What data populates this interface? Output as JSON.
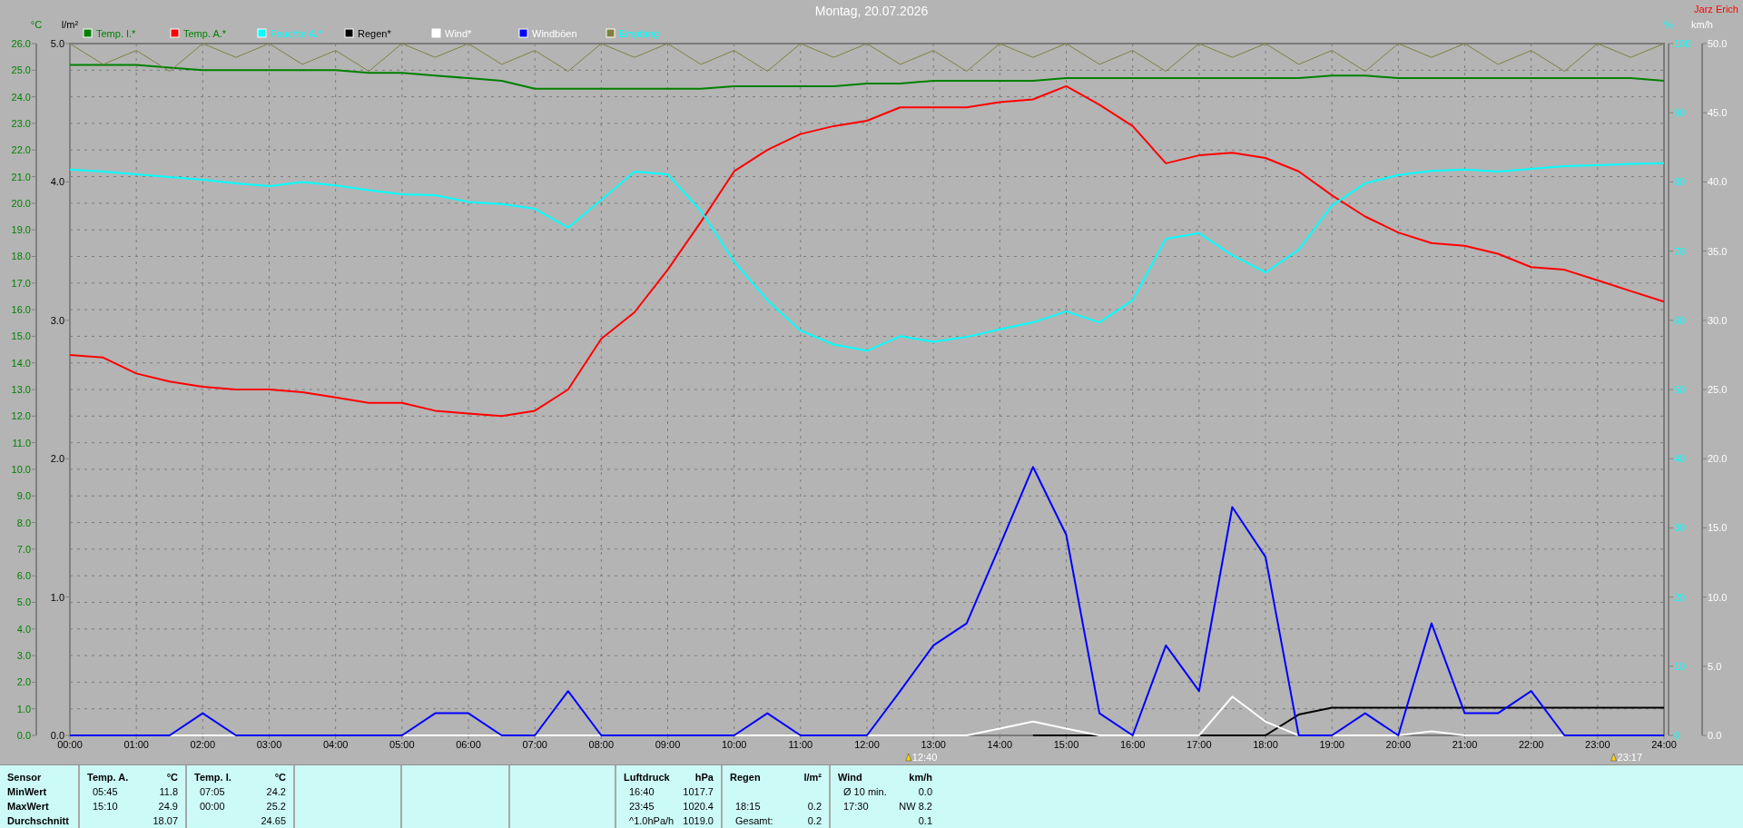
{
  "author": "Jarz Erich",
  "charts": [
    {
      "chart_data": {
        "type": "line",
        "title": "Montag, 20.07.2026",
        "ylabel": "°C",
        "y2label": "l/m²",
        "y3label": "%",
        "x": [
          0,
          0.5,
          1,
          1.5,
          2,
          2.5,
          3,
          3.5,
          4,
          4.5,
          5,
          5.5,
          6,
          6.5,
          7,
          7.5,
          8,
          8.5,
          9,
          9.5,
          10,
          10.5,
          11,
          11.5,
          12,
          12.5,
          13,
          13.5,
          14,
          14.5,
          15,
          15.5,
          16,
          16.5,
          17,
          17.5,
          18,
          18.5,
          19,
          19.5,
          20,
          20.5,
          21,
          21.5,
          22,
          22.5,
          23,
          23.5,
          24
        ],
        "xlim": [
          0,
          24
        ],
        "xticks": [
          {
            "value": 0,
            "label": "00:00"
          },
          {
            "value": 1,
            "label": "01:00"
          },
          {
            "value": 2,
            "label": "02:00"
          },
          {
            "value": 3,
            "label": "03:00"
          },
          {
            "value": 4,
            "label": "04:00"
          },
          {
            "value": 5,
            "label": "05:00"
          },
          {
            "value": 6,
            "label": "06:00"
          },
          {
            "value": 7,
            "label": "07:00"
          },
          {
            "value": 8,
            "label": "08:00"
          },
          {
            "value": 9,
            "label": "09:00"
          },
          {
            "value": 10,
            "label": "10:00"
          },
          {
            "value": 11,
            "label": "11:00"
          },
          {
            "value": 12,
            "label": "12:00"
          },
          {
            "value": 13,
            "label": "13:00"
          },
          {
            "value": 14,
            "label": "14:00"
          },
          {
            "value": 15,
            "label": "15:00"
          },
          {
            "value": 16,
            "label": "16:00"
          },
          {
            "value": 17,
            "label": "17:00"
          },
          {
            "value": 18,
            "label": "18:00"
          },
          {
            "value": 19,
            "label": "19:00"
          },
          {
            "value": 20,
            "label": "20:00"
          },
          {
            "value": 21,
            "label": "21:00"
          },
          {
            "value": 22,
            "label": "22:00"
          },
          {
            "value": 23,
            "label": "23:00"
          },
          {
            "value": 24,
            "label": "24:00"
          }
        ],
        "ylim": [
          0,
          26
        ],
        "yticks": [
          {
            "value": 0,
            "label": "0.0"
          },
          {
            "value": 1,
            "label": "1.0"
          },
          {
            "value": 2,
            "label": "2.0"
          },
          {
            "value": 3,
            "label": "3.0"
          },
          {
            "value": 4,
            "label": "4.0"
          },
          {
            "value": 5,
            "label": "5.0"
          },
          {
            "value": 6,
            "label": "6.0"
          },
          {
            "value": 7,
            "label": "7.0"
          },
          {
            "value": 8,
            "label": "8.0"
          },
          {
            "value": 9,
            "label": "9.0"
          },
          {
            "value": 10,
            "label": "10.0"
          },
          {
            "value": 11,
            "label": "11.0"
          },
          {
            "value": 12,
            "label": "12.0"
          },
          {
            "value": 13,
            "label": "13.0"
          },
          {
            "value": 14,
            "label": "14.0"
          },
          {
            "value": 15,
            "label": "15.0"
          },
          {
            "value": 16,
            "label": "16.0"
          },
          {
            "value": 17,
            "label": "17.0"
          },
          {
            "value": 18,
            "label": "18.0"
          },
          {
            "value": 19,
            "label": "19.0"
          },
          {
            "value": 20,
            "label": "20.0"
          },
          {
            "value": 21,
            "label": "21.0"
          },
          {
            "value": 22,
            "label": "22.0"
          },
          {
            "value": 23,
            "label": "23.0"
          },
          {
            "value": 24,
            "label": "24.0"
          },
          {
            "value": 25,
            "label": "25.0"
          },
          {
            "value": 26,
            "label": "26.0"
          }
        ],
        "y2lim": [
          0,
          5
        ],
        "y2ticks": [
          {
            "value": 0,
            "label": "0.0"
          },
          {
            "value": 1,
            "label": "1.0"
          },
          {
            "value": 2,
            "label": "2.0"
          },
          {
            "value": 3,
            "label": "3.0"
          },
          {
            "value": 4,
            "label": "4.0"
          },
          {
            "value": 5,
            "label": "5.0"
          }
        ],
        "y3lim": [
          0,
          100
        ],
        "y3ticks": [
          0,
          10,
          20,
          30,
          40,
          50,
          60,
          70,
          80,
          90,
          100
        ],
        "series": [
          {
            "name": "Temp. I.*",
            "color": "#008000",
            "values": [
              25.2,
              25.2,
              25.2,
              25.1,
              25.0,
              25.0,
              25.0,
              25.0,
              25.0,
              24.9,
              24.9,
              24.8,
              24.7,
              24.6,
              24.3,
              24.3,
              24.3,
              24.3,
              24.3,
              24.3,
              24.4,
              24.4,
              24.4,
              24.4,
              24.5,
              24.5,
              24.6,
              24.6,
              24.6,
              24.6,
              24.7,
              24.7,
              24.7,
              24.7,
              24.7,
              24.7,
              24.7,
              24.7,
              24.8,
              24.8,
              24.7,
              24.7,
              24.7,
              24.7,
              24.7,
              24.7,
              24.7,
              24.7,
              24.6
            ]
          },
          {
            "name": "Temp. A.*",
            "color": "#ff0000",
            "values": [
              14.3,
              14.2,
              13.6,
              13.3,
              13.1,
              13.0,
              13.0,
              12.9,
              12.7,
              12.5,
              12.5,
              12.2,
              12.1,
              12.0,
              12.2,
              13.0,
              14.9,
              15.9,
              17.5,
              19.3,
              21.2,
              22.0,
              22.6,
              22.9,
              23.1,
              23.6,
              23.6,
              23.6,
              23.8,
              23.9,
              24.4,
              23.7,
              22.9,
              21.5,
              21.8,
              21.9,
              21.7,
              21.2,
              20.3,
              19.5,
              18.9,
              18.5,
              18.4,
              18.1,
              17.6,
              17.5,
              17.1,
              16.7,
              16.3
            ]
          },
          {
            "name": "Feuchte A.*",
            "color": "#00ffff",
            "axis": "y3",
            "values": [
              81.8,
              81.5,
              81.1,
              80.7,
              80.3,
              79.8,
              79.4,
              80.0,
              79.5,
              78.8,
              78.2,
              78.1,
              77.1,
              76.8,
              76.1,
              73.4,
              77.4,
              81.5,
              81.1,
              75.8,
              68.5,
              62.9,
              58.5,
              56.5,
              55.6,
              57.7,
              56.9,
              57.6,
              58.7,
              59.7,
              61.3,
              59.7,
              62.9,
              71.8,
              72.6,
              69.4,
              66.9,
              70.2,
              76.6,
              79.8,
              81.0,
              81.6,
              81.8,
              81.5,
              81.9,
              82.3,
              82.4,
              82.6,
              82.7
            ]
          },
          {
            "name": "Regen*",
            "color": "#000000",
            "axis": "y2",
            "values": [
              null,
              null,
              null,
              null,
              null,
              null,
              null,
              null,
              null,
              null,
              null,
              null,
              null,
              null,
              null,
              null,
              null,
              null,
              null,
              null,
              null,
              null,
              null,
              null,
              null,
              null,
              null,
              null,
              null,
              0,
              0,
              0,
              0,
              0,
              0,
              0,
              0,
              0.15,
              0.2,
              0.2,
              0.2,
              0.2,
              0.2,
              0.2,
              0.2,
              0.2,
              0.2,
              0.2,
              0.2
            ]
          },
          {
            "name": "Empfang",
            "color": "#808040",
            "axis": "y3",
            "values": [
              100,
              97,
              99,
              96,
              100,
              98,
              100,
              97,
              99,
              96,
              100,
              98,
              100,
              97,
              99,
              96,
              100,
              98,
              100,
              97,
              99,
              96,
              100,
              98,
              100,
              97,
              99,
              96,
              100,
              98,
              100,
              97,
              99,
              96,
              100,
              98,
              100,
              97,
              99,
              96,
              100,
              98,
              100,
              97,
              99,
              96,
              100,
              98,
              100
            ]
          }
        ],
        "annotations": [
          "12:40",
          "23:17"
        ],
        "grid": true,
        "legend": "top"
      }
    },
    {
      "chart_data": {
        "type": "line",
        "ylabel": "km/h",
        "legend": "top",
        "x": [
          0,
          0.5,
          1,
          1.5,
          2,
          2.5,
          3,
          3.5,
          4,
          4.5,
          5,
          5.5,
          6,
          6.5,
          7,
          7.5,
          8,
          8.5,
          9,
          9.5,
          10,
          10.5,
          11,
          11.5,
          12,
          12.5,
          13,
          13.5,
          14,
          14.5,
          15,
          15.5,
          16,
          16.5,
          17,
          17.5,
          18,
          18.5,
          19,
          19.5,
          20,
          20.5,
          21,
          21.5,
          22,
          22.5,
          23,
          23.5,
          24
        ],
        "xlim": [
          0,
          24
        ],
        "ylim": [
          0,
          50
        ],
        "yticks": [
          {
            "value": 0,
            "label": "0.0"
          },
          {
            "value": 5,
            "label": "5.0"
          },
          {
            "value": 10,
            "label": "10.0"
          },
          {
            "value": 15,
            "label": "15.0"
          },
          {
            "value": 20,
            "label": "20.0"
          },
          {
            "value": 25,
            "label": "25.0"
          },
          {
            "value": 30,
            "label": "30.0"
          },
          {
            "value": 35,
            "label": "35.0"
          },
          {
            "value": 40,
            "label": "40.0"
          },
          {
            "value": 45,
            "label": "45.0"
          },
          {
            "value": 50,
            "label": "50.0"
          }
        ],
        "series": [
          {
            "name": "Wind*",
            "color": "#ffffff",
            "values": [
              null,
              null,
              0,
              0,
              0,
              0,
              0,
              0,
              0,
              0,
              0,
              0,
              0,
              0,
              0,
              0,
              0,
              0,
              0,
              0,
              0,
              0,
              0,
              0,
              0,
              0,
              0,
              0,
              0.5,
              1.0,
              0.5,
              0,
              0,
              0,
              0,
              2.8,
              1.0,
              0,
              0,
              0,
              0,
              0.3,
              0,
              0,
              0,
              0,
              0,
              null,
              null
            ]
          },
          {
            "name": "Windböen",
            "color": "#0000ff",
            "values": [
              0,
              0,
              0,
              0,
              1.6,
              0,
              0,
              0,
              0,
              0,
              0,
              1.6,
              1.6,
              0,
              0,
              3.2,
              0,
              0,
              0,
              0,
              0,
              1.6,
              0,
              0,
              0,
              3.2,
              6.5,
              8.1,
              13.7,
              19.4,
              14.5,
              1.6,
              0,
              6.5,
              3.2,
              16.5,
              12.9,
              0,
              0,
              1.6,
              0,
              8.1,
              1.6,
              1.6,
              3.2,
              0,
              0,
              0,
              0
            ]
          }
        ]
      }
    }
  ],
  "table": {
    "sections": [
      {
        "kind": "labels",
        "rows": [
          [
            "Sensor"
          ],
          [
            "MinWert"
          ],
          [
            "MaxWert"
          ],
          [
            "Durchschnitt"
          ]
        ]
      },
      {
        "kind": "values",
        "rows": [
          [
            "Temp. A.",
            "°C"
          ],
          [
            "05:45",
            "11.8"
          ],
          [
            "15:10",
            "24.9"
          ],
          [
            null,
            "18.07"
          ]
        ]
      },
      {
        "kind": "values",
        "rows": [
          [
            "Temp. I.",
            "°C"
          ],
          [
            "07:05",
            "24.2"
          ],
          [
            "00:00",
            "25.2"
          ],
          [
            null,
            "24.65"
          ]
        ]
      },
      {
        "kind": "empty"
      },
      {
        "kind": "empty"
      },
      {
        "kind": "empty"
      },
      {
        "kind": "values",
        "rows": [
          [
            "Luftdruck",
            "hPa"
          ],
          [
            "16:40",
            "1017.7"
          ],
          [
            "23:45",
            "1020.4"
          ],
          [
            "^1.0hPa/h",
            "1019.0"
          ]
        ]
      },
      {
        "kind": "values",
        "rows": [
          [
            "Regen",
            "l/m²"
          ],
          [
            null,
            null
          ],
          [
            "18:15",
            "0.2"
          ],
          [
            "Gesamt:",
            "0.2"
          ]
        ]
      },
      {
        "kind": "values",
        "rows": [
          [
            "Wind",
            "km/h"
          ],
          [
            "Ø 10 min.",
            "0.0"
          ],
          [
            "17:30",
            "NW 8.2"
          ],
          [
            null,
            "0.1"
          ]
        ]
      }
    ]
  }
}
